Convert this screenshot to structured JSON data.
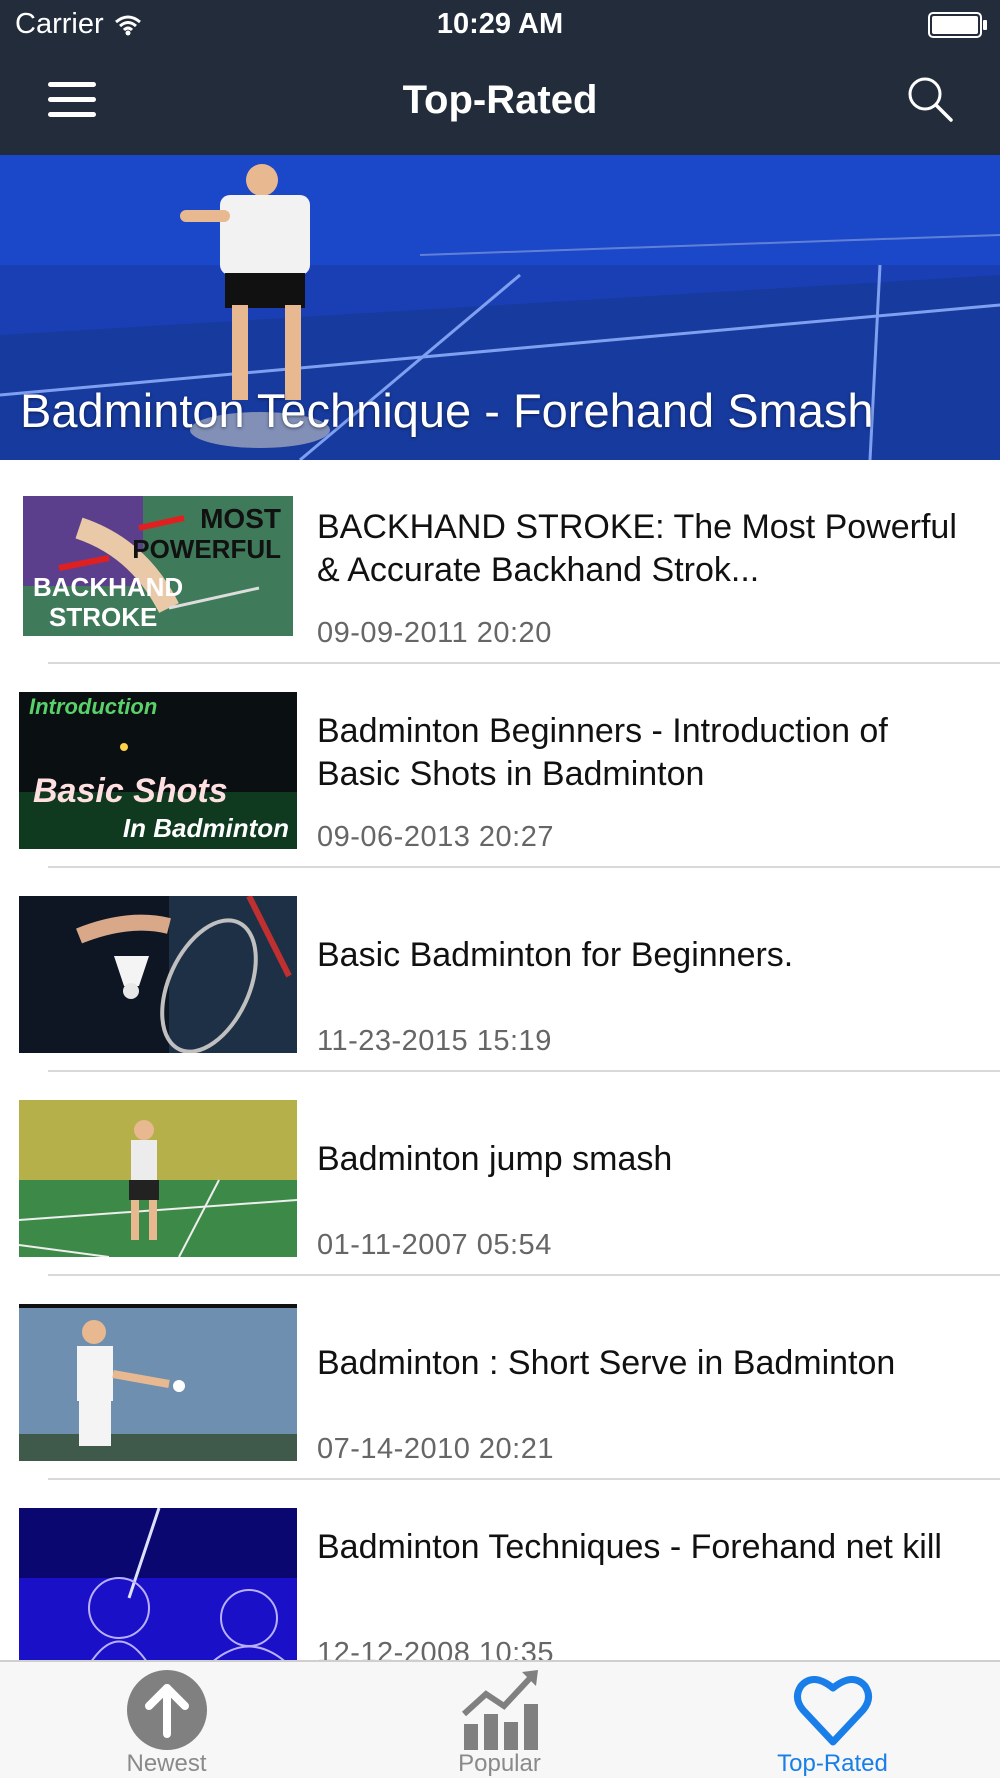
{
  "status_bar": {
    "carrier": "Carrier",
    "time": "10:29 AM"
  },
  "nav": {
    "title": "Top-Rated",
    "menu_icon": "hamburger-menu-icon",
    "search_icon": "search-icon"
  },
  "hero": {
    "title": "Badminton Technique - Forehand Smash"
  },
  "videos": [
    {
      "title": "BACKHAND STROKE: The Most Powerful & Accurate Backhand Strok...",
      "date": "09-09-2011 20:20",
      "thumb_text": [
        "MOST",
        "POWERFUL",
        "BACKHAND",
        "STROKE"
      ]
    },
    {
      "title": "Badminton Beginners - Introduction of Basic Shots in Badminton",
      "date": "09-06-2013 20:27",
      "thumb_text": [
        "Introduction",
        "Basic Shots",
        "In Badminton"
      ]
    },
    {
      "title": "Basic Badminton for Beginners.",
      "date": "11-23-2015 15:19"
    },
    {
      "title": "Badminton jump smash",
      "date": "01-11-2007 05:54"
    },
    {
      "title": "Badminton : Short Serve in Badminton",
      "date": "07-14-2010 20:21"
    },
    {
      "title": "Badminton Techniques - Forehand net kill",
      "date": "12-12-2008 10:35"
    }
  ],
  "tabs": [
    {
      "label": "Newest",
      "icon": "upload-arrow-icon",
      "active": false
    },
    {
      "label": "Popular",
      "icon": "trending-chart-icon",
      "active": false
    },
    {
      "label": "Top-Rated",
      "icon": "heart-icon",
      "active": true
    }
  ],
  "colors": {
    "nav_background": "#222c3a",
    "active_tab": "#1a7ee8",
    "inactive_tab": "#8a8a8a"
  }
}
